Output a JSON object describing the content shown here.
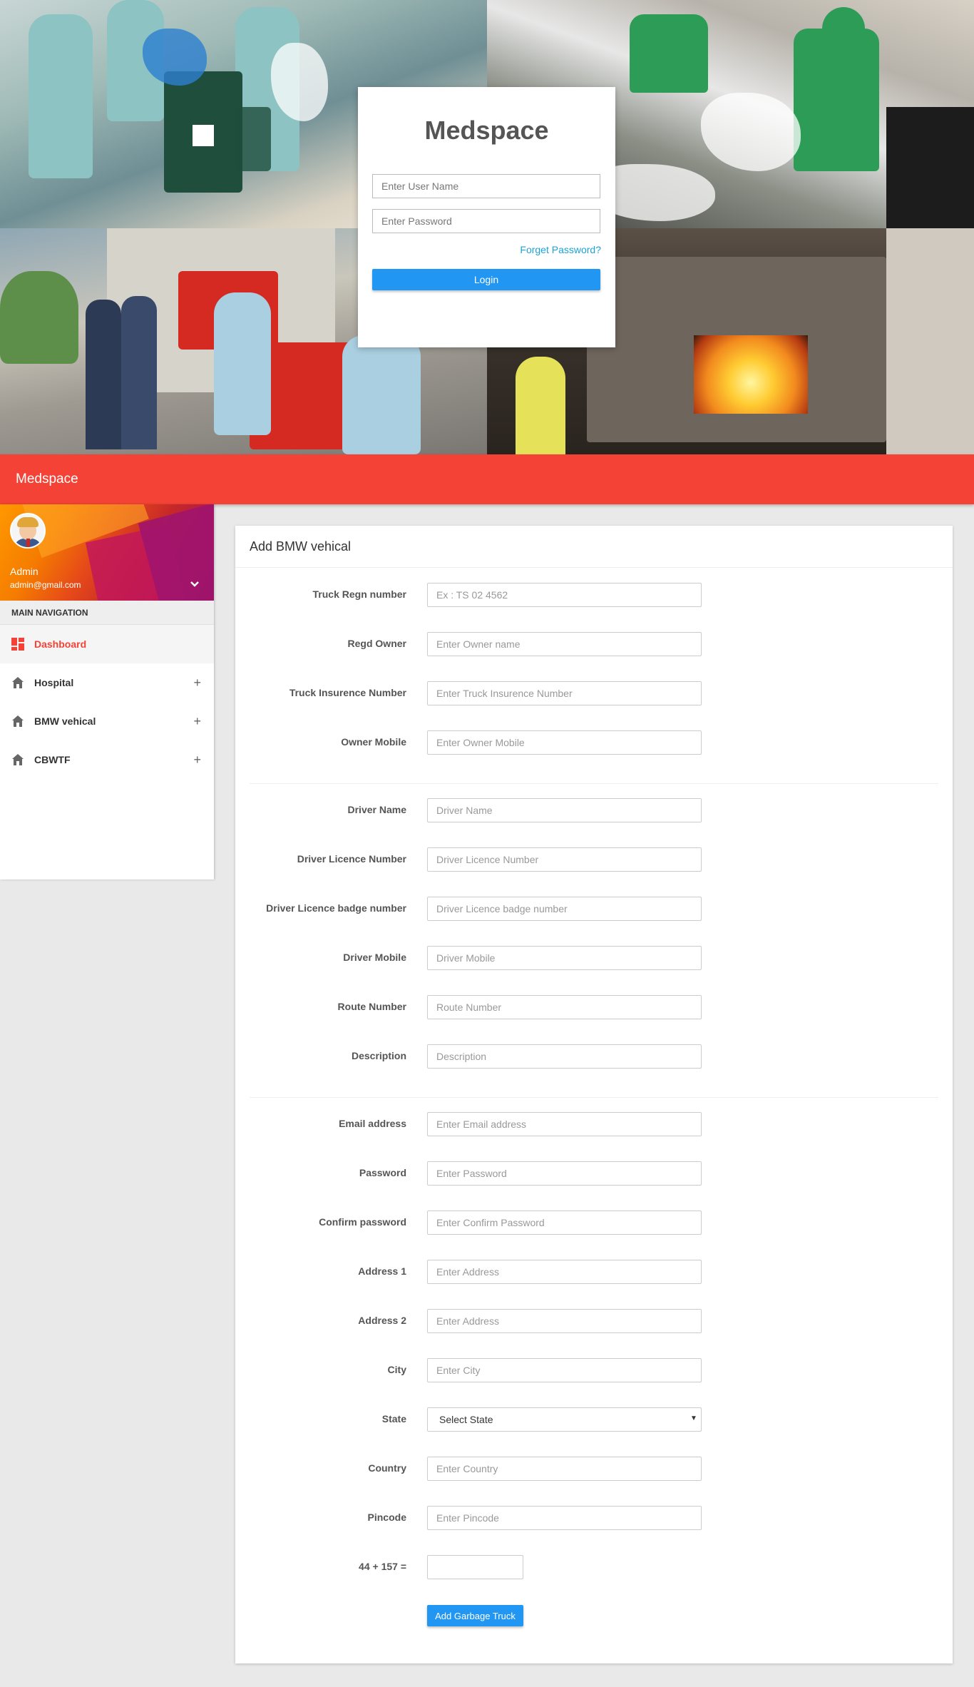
{
  "login": {
    "title": "Medspace",
    "username_placeholder": "Enter User Name",
    "password_placeholder": "Enter Password",
    "forget_label": "Forget Password?",
    "login_label": "Login"
  },
  "topbar": {
    "brand": "Medspace"
  },
  "sidebar": {
    "user_name": "Admin",
    "user_email": "admin@gmail.com",
    "nav_header": "MAIN NAVIGATION",
    "items": [
      {
        "label": "Dashboard",
        "icon": "dashboard-icon",
        "active": true
      },
      {
        "label": "Hospital",
        "icon": "home-icon"
      },
      {
        "label": "BMW vehical",
        "icon": "home-icon"
      },
      {
        "label": "CBWTF",
        "icon": "home-icon"
      }
    ],
    "accent": "#f44336"
  },
  "form": {
    "title": "Add BMW vehical",
    "fields": [
      {
        "label": "Truck Regn number",
        "placeholder": "Ex : TS 02 4562"
      },
      {
        "label": "Regd Owner",
        "placeholder": "Enter Owner name"
      },
      {
        "label": "Truck Insurence Number",
        "placeholder": "Enter Truck Insurence Number"
      },
      {
        "label": "Owner Mobile",
        "placeholder": "Enter Owner Mobile"
      },
      {
        "label": "Driver Name",
        "placeholder": "Driver Name"
      },
      {
        "label": "Driver Licence Number",
        "placeholder": "Driver Licence Number"
      },
      {
        "label": "Driver Licence badge number",
        "placeholder": "Driver Licence badge number"
      },
      {
        "label": "Driver Mobile",
        "placeholder": "Driver Mobile"
      },
      {
        "label": "Route Number",
        "placeholder": "Route Number"
      },
      {
        "label": "Description",
        "placeholder": "Description"
      },
      {
        "label": "Email address",
        "placeholder": "Enter Email address"
      },
      {
        "label": "Password",
        "placeholder": "Enter Password"
      },
      {
        "label": "Confirm password",
        "placeholder": "Enter Confirm Password"
      },
      {
        "label": "Address 1",
        "placeholder": "Enter Address"
      },
      {
        "label": "Address 2",
        "placeholder": "Enter Address"
      },
      {
        "label": "City",
        "placeholder": "Enter City"
      },
      {
        "label": "State",
        "selected": "Select State"
      },
      {
        "label": "Country",
        "placeholder": "Enter Country"
      },
      {
        "label": "Pincode",
        "placeholder": "Enter Pincode"
      },
      {
        "label": "44 + 157 =",
        "placeholder": ""
      }
    ],
    "submit_label": "Add Garbage Truck",
    "button_color": "#2196f3"
  }
}
